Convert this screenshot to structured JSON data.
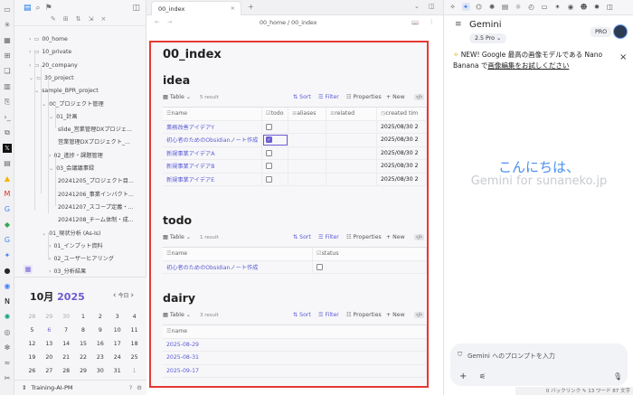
{
  "ribbon": {
    "icons": [
      "folder-icon",
      "graph-icon",
      "calendar-icon",
      "canvas-icon",
      "layers-icon",
      "book-icon",
      "template-icon",
      "terminal-icon",
      "copy-icon",
      "x-icon",
      "kanban-icon",
      "drive-icon",
      "gmail-icon",
      "google-icon",
      "maps-icon",
      "google-icon",
      "gemini-icon",
      "github-icon",
      "assistant-icon",
      "notion-icon",
      "chatgpt-icon",
      "notebook-icon",
      "perplexity-icon",
      "ai-icon",
      "tools-icon"
    ]
  },
  "sidebar": {
    "tree": [
      {
        "label": "00_home",
        "indent": 1,
        "chev": "›",
        "type": "folder"
      },
      {
        "label": "10_private",
        "indent": 1,
        "chev": "›",
        "type": "folder"
      },
      {
        "label": "20_company",
        "indent": 1,
        "chev": "›",
        "type": "folder"
      },
      {
        "label": "30_project",
        "indent": 1,
        "chev": "⌄",
        "type": "folder"
      },
      {
        "label": "sample_BPR_project",
        "indent": 2,
        "chev": "⌄",
        "type": "none"
      },
      {
        "label": "00_プロジェクト管理",
        "indent": 3,
        "chev": "⌄",
        "type": "none"
      },
      {
        "label": "01_計画",
        "indent": 4,
        "chev": "⌄",
        "type": "none"
      },
      {
        "label": "slide_営業管理DXプロジェ...",
        "indent": 5,
        "chev": "",
        "type": "none"
      },
      {
        "label": "営業管理DXプロジェクト_...",
        "indent": 5,
        "chev": "",
        "type": "none"
      },
      {
        "label": "02_進捗・課題管理",
        "indent": 4,
        "chev": "›",
        "type": "none"
      },
      {
        "label": "03_会議議事録",
        "indent": 4,
        "chev": "⌄",
        "type": "none"
      },
      {
        "label": "20241205_プロジェクト目...",
        "indent": 5,
        "chev": "",
        "type": "none"
      },
      {
        "label": "20241206_事業インパクト...",
        "indent": 5,
        "chev": "",
        "type": "none"
      },
      {
        "label": "20241207_スコープ定義・...",
        "indent": 5,
        "chev": "",
        "type": "none"
      },
      {
        "label": "20241208_チーム体制・成...",
        "indent": 5,
        "chev": "",
        "type": "none"
      },
      {
        "label": "01_現状分析 (As-Is)",
        "indent": 3,
        "chev": "⌄",
        "type": "none"
      },
      {
        "label": "01_インプット資料",
        "indent": 4,
        "chev": "›",
        "type": "none"
      },
      {
        "label": "02_ユーザーヒアリング",
        "indent": 4,
        "chev": "›",
        "type": "none"
      },
      {
        "label": "03_分析結果",
        "indent": 4,
        "chev": "›",
        "type": "none"
      }
    ]
  },
  "calendar": {
    "month": "10月",
    "year": "2025",
    "today": "今日",
    "rows": [
      [
        "28",
        "29",
        "30",
        "1",
        "2",
        "3",
        "4"
      ],
      [
        "5",
        "6",
        "7",
        "8",
        "9",
        "10",
        "11"
      ],
      [
        "12",
        "13",
        "14",
        "15",
        "16",
        "17",
        "18"
      ],
      [
        "19",
        "20",
        "21",
        "22",
        "23",
        "24",
        "25"
      ],
      [
        "26",
        "27",
        "28",
        "29",
        "30",
        "31",
        "1"
      ]
    ]
  },
  "vault": {
    "name": "Training-AI-PM"
  },
  "tab": {
    "title": "00_index"
  },
  "navbar": {
    "breadcrumb": "00_home / 00_index"
  },
  "doc": {
    "title": "00_index",
    "sections": [
      {
        "heading": "idea",
        "view": "Table",
        "count": "5 result",
        "columns": [
          "name",
          "todo",
          "aliases",
          "related",
          "created tim"
        ],
        "rows": [
          {
            "name": "業務改善アイデアY",
            "todo": false,
            "created": "2025/08/30 2"
          },
          {
            "name": "初心者のためのObsidianノート作成",
            "todo": true,
            "created": "2025/08/30 2"
          },
          {
            "name": "新規事業アイデアA",
            "todo": false,
            "created": "2025/08/30 2"
          },
          {
            "name": "新規事業アイデアB",
            "todo": false,
            "created": "2025/08/30 2"
          },
          {
            "name": "新規事業アイデアE",
            "todo": false,
            "created": "2025/08/30 2"
          }
        ]
      },
      {
        "heading": "todo",
        "view": "Table",
        "count": "1 result",
        "columns": [
          "name",
          "status"
        ],
        "rows": [
          {
            "name": "初心者のためのObsidianノート作成",
            "status": false
          }
        ]
      },
      {
        "heading": "dairy",
        "view": "Table",
        "count": "3 result",
        "columns": [
          "name"
        ],
        "rows": [
          {
            "name": "2025-08-29"
          },
          {
            "name": "2025-08-31"
          },
          {
            "name": "2025-09-17"
          }
        ]
      }
    ],
    "toolbar": {
      "sort": "Sort",
      "filter": "Filter",
      "properties": "Properties",
      "new": "New"
    }
  },
  "gemini": {
    "title": "Gemini",
    "model": "2.5 Pro",
    "pro": "PRO",
    "notice_text": "NEW! Google 最高の画像モデルである Nano Banana で",
    "notice_link": "画像編集をお試しください",
    "hello": "こんにちは、",
    "sub": "Gemini for sunaneko.jp",
    "placeholder": "Gemini へのプロンプトを入力"
  },
  "status": {
    "text": "0 バックリンク  ✎  13 ワード  87 文字"
  },
  "colors": {
    "accent": "#6b5bd2",
    "link": "#5b5bd6",
    "highlight": "#e53935",
    "gemini_blue": "#4a8ff0"
  }
}
